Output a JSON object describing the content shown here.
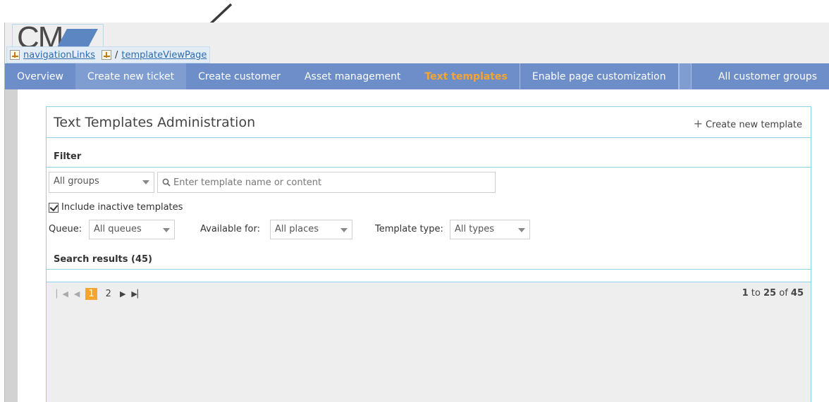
{
  "logo": {
    "text": "CM"
  },
  "breadcrumb": {
    "first": "navigationLinks",
    "separator": "/",
    "second": "templateViewPage"
  },
  "nav": {
    "items": [
      {
        "label": "Overview"
      },
      {
        "label": "Create new ticket"
      },
      {
        "label": "Create customer"
      },
      {
        "label": "Asset management"
      },
      {
        "label": "Text templates"
      },
      {
        "label": "Enable page customization"
      }
    ],
    "right": "All customer groups"
  },
  "panel": {
    "title": "Text Templates Administration",
    "create_label": "Create new template"
  },
  "filter": {
    "label": "Filter",
    "group_select": "All groups",
    "search_placeholder": "Enter template name or content",
    "include_inactive": "Include inactive templates",
    "queue_label": "Queue:",
    "queue_value": "All queues",
    "available_label": "Available for:",
    "available_value": "All places",
    "type_label": "Template type:",
    "type_value": "All types"
  },
  "results": {
    "label": "Search results (45)"
  },
  "pagination": {
    "pages": [
      "1",
      "2"
    ],
    "current": "1",
    "range_from": "1",
    "range_to": "25",
    "range_sep": "to",
    "range_of": "of",
    "total": "45"
  },
  "colors": {
    "nav_bg": "#6d8ec8",
    "nav_active": "#f6a531",
    "panel_border": "#8ed3e8",
    "page_current_bg": "#f6a531"
  }
}
